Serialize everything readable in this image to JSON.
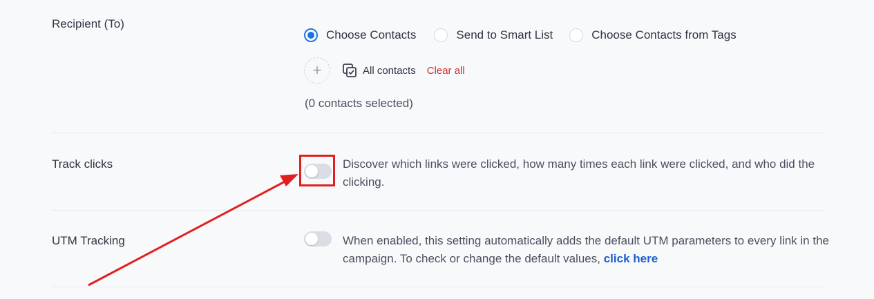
{
  "recipient": {
    "label": "Recipient (To)",
    "options": [
      {
        "label": "Choose Contacts",
        "selected": true
      },
      {
        "label": "Send to Smart List",
        "selected": false
      },
      {
        "label": "Choose Contacts from Tags",
        "selected": false
      }
    ],
    "all_contacts_label": "All contacts",
    "clear_all_label": "Clear all",
    "selected_count_text": "(0 contacts selected)"
  },
  "track_clicks": {
    "label": "Track clicks",
    "enabled": false,
    "description": "Discover which links were clicked, how many times each link were clicked, and who did the clicking."
  },
  "utm_tracking": {
    "label": "UTM Tracking",
    "enabled": false,
    "description": "When enabled, this setting automatically adds the default UTM parameters to every link in the campaign. To check or change the default values,",
    "link_label": "click here"
  },
  "colors": {
    "accent": "#1a73e8",
    "danger": "#d52b2b",
    "annotation": "#e02020",
    "link": "#1a5fd0"
  },
  "icons": {
    "add": "plus-icon",
    "contacts": "contacts-checkbox-icon"
  }
}
